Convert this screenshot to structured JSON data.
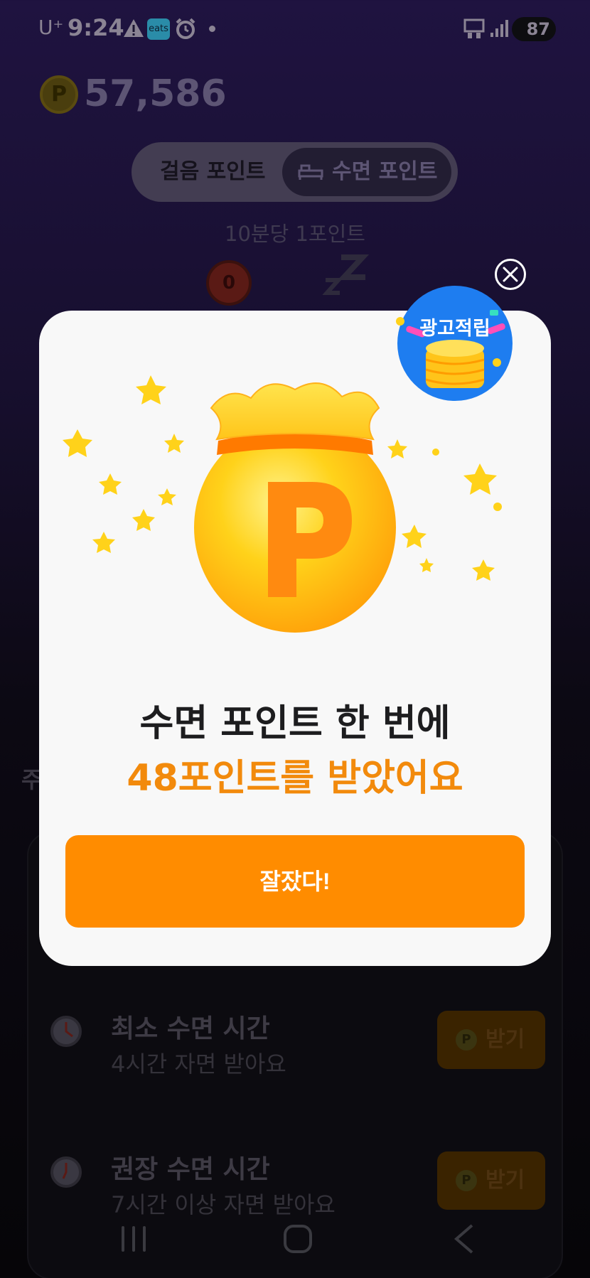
{
  "status_bar": {
    "carrier": "U⁺",
    "time": "9:24",
    "app_badge": "eats",
    "battery": "87"
  },
  "points": {
    "coin_symbol": "P",
    "value": "57,586"
  },
  "tabs": {
    "walk": "걸음 포인트",
    "sleep": "수면 포인트"
  },
  "rate_text": "10분당 1포인트",
  "sleep_counter": "0",
  "background_cut_char": "주",
  "rewards": [
    {
      "title": "최소 수면 시간",
      "subtitle": "4시간 자면 받아요",
      "button_label": "받기"
    },
    {
      "title": "권장 수면 시간",
      "subtitle": "7시간 이상 자면 받아요",
      "button_label": "받기"
    }
  ],
  "modal": {
    "ad_badge": "광고적립",
    "line1": "수면 포인트 한 번에",
    "line2": "48포인트를 받았어요",
    "confirm_label": "잘잤다!"
  },
  "colors": {
    "accent": "#ff8c00",
    "highlight_text": "#f28a0c",
    "modal_bg": "#f8f8f8",
    "ad_badge_bg": "#1e7df0"
  }
}
